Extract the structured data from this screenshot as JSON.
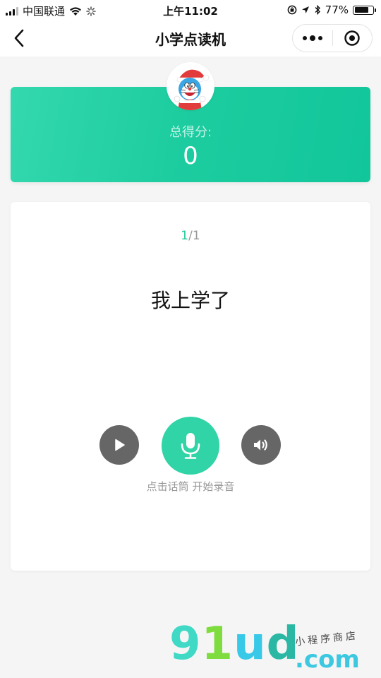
{
  "status_bar": {
    "carrier": "中国联通",
    "time": "上午11:02",
    "battery_text": "77%",
    "battery_level": 0.77
  },
  "nav": {
    "title": "小学点读机"
  },
  "score": {
    "label": "总得分:",
    "value": "0"
  },
  "reader": {
    "page_current": "1",
    "page_separator": "/",
    "page_total": "1",
    "sentence": "我上学了",
    "hint": "点击话筒 开始录音"
  },
  "watermark": {
    "logo": "91ud",
    "domain": ".com",
    "tagline": "小程序商店"
  },
  "colors": {
    "accent": "#20c89d",
    "mic_button": "#31d4a6",
    "control_gray": "#666666"
  }
}
